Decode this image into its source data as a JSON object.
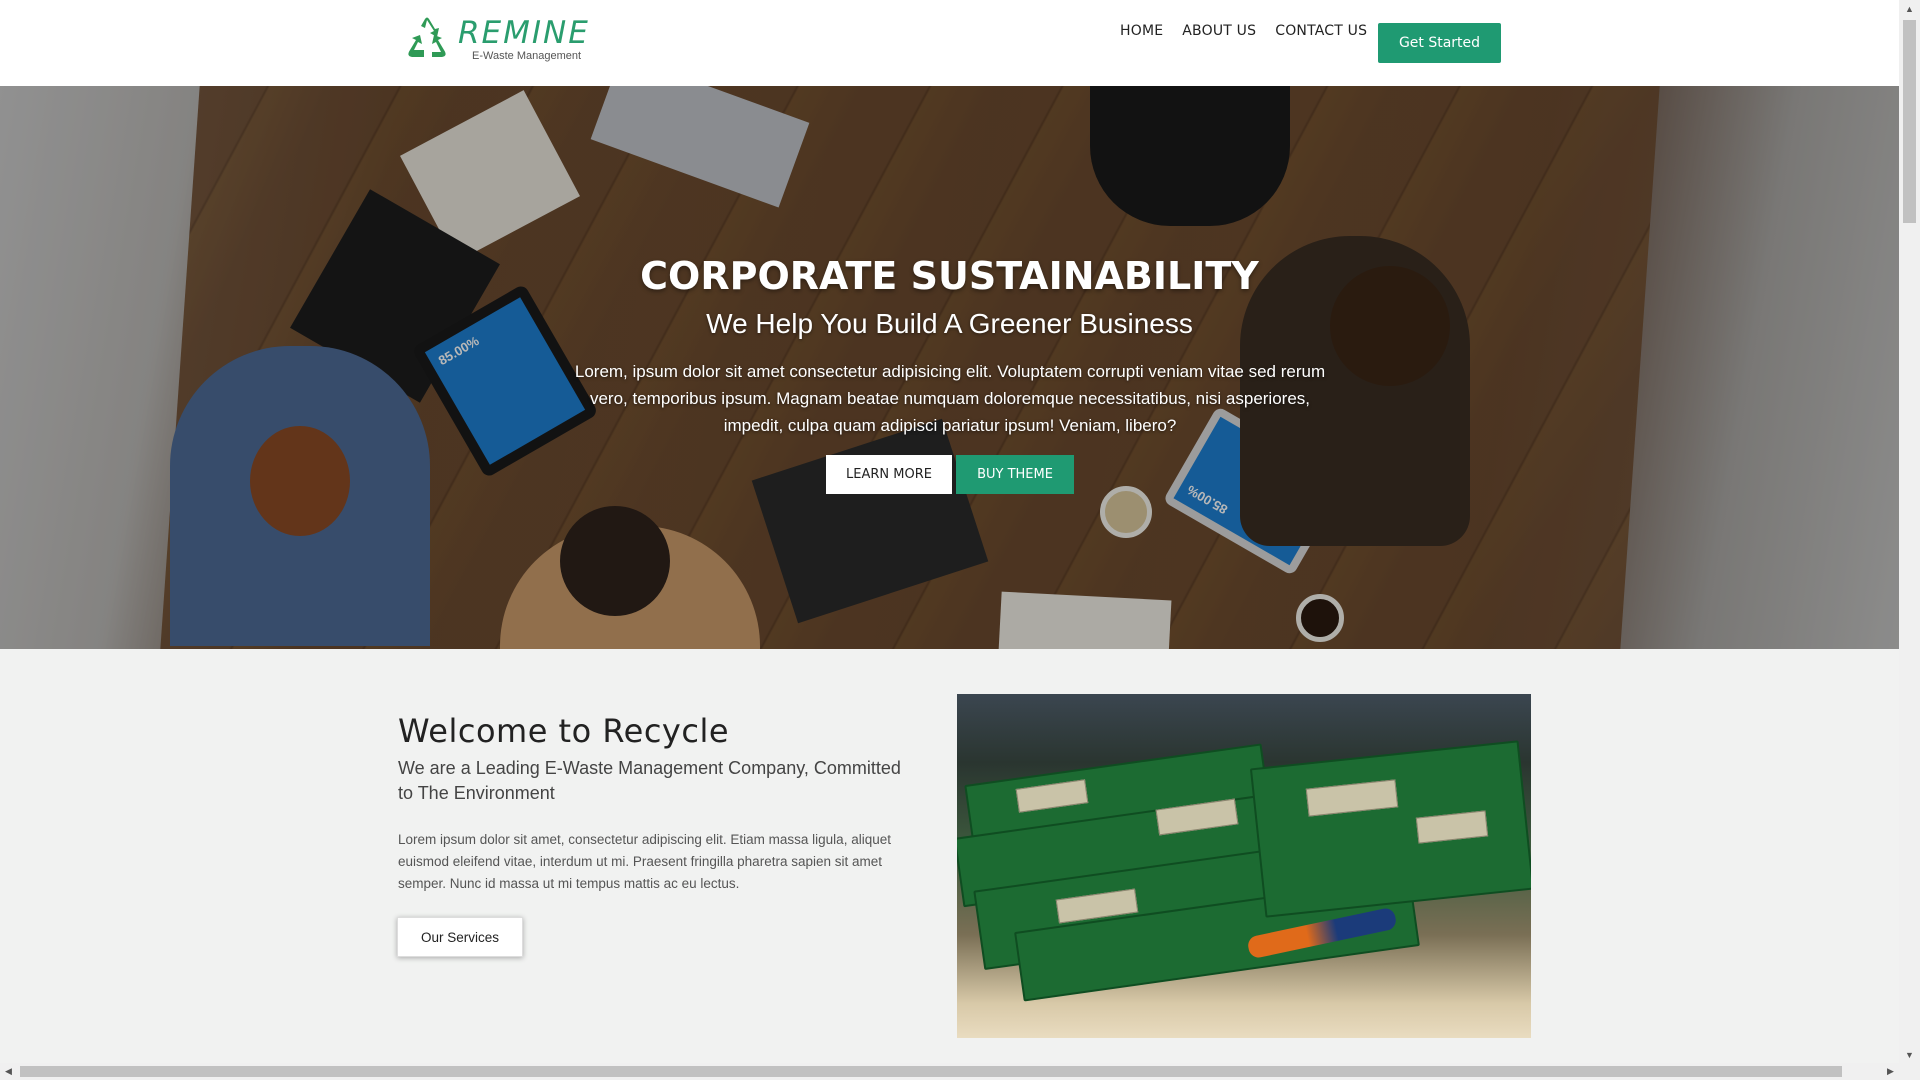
{
  "header": {
    "logo_title": "REMINE",
    "logo_subtitle": "E-Waste Management",
    "nav": [
      "HOME",
      "ABOUT US",
      "CONTACT US"
    ],
    "cta": "Get Started",
    "accent": "#1f9a72"
  },
  "hero": {
    "title": "CORPORATE SUSTAINABILITY",
    "subtitle": "We Help You Build A Greener Business",
    "text": "Lorem, ipsum dolor sit amet consectetur adipisicing elit. Voluptatem corrupti veniam vitae sed rerum vero, temporibus ipsum. Magnam beatae numquam doloremque necessitatibus, nisi asperiores, impedit, culpa quam adipisci pariatur ipsum! Veniam, libero?",
    "btn_learn": "LEARN MORE",
    "btn_buy": "BUY THEME",
    "tablet_left_text": "85.00%",
    "tablet_right_text": "85.00%"
  },
  "welcome": {
    "title": "Welcome to Recycle",
    "subtitle": "We are a Leading E-Waste Management Company, Committed to The Environment",
    "text": "Lorem ipsum dolor sit amet, consectetur adipiscing elit. Etiam massa ligula, aliquet euismod eleifend vitae, interdum ut mi. Praesent fringilla pharetra sapien sit amet semper. Nunc id massa ut mi tempus mattis ac eu lectus.",
    "btn_services": "Our Services"
  }
}
